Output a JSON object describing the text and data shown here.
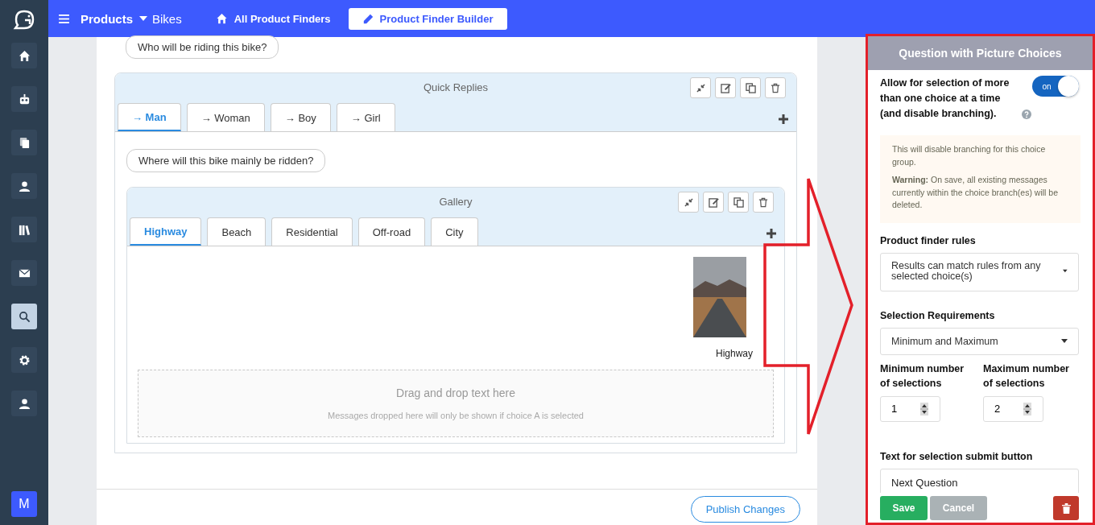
{
  "sidebar": {
    "items": [
      {
        "kind": "home",
        "selected": false
      },
      {
        "kind": "robot",
        "selected": false
      },
      {
        "kind": "documents",
        "selected": false
      },
      {
        "kind": "user",
        "selected": false
      },
      {
        "kind": "books",
        "selected": false
      },
      {
        "kind": "mail",
        "selected": false
      },
      {
        "kind": "search",
        "selected": true
      },
      {
        "kind": "settings",
        "selected": false
      },
      {
        "kind": "user",
        "selected": false
      }
    ],
    "avatar": "M"
  },
  "topbar": {
    "section": "Products",
    "subsection": "Bikes",
    "nav": [
      {
        "label": "All Product Finders",
        "kind": "home",
        "selected": false
      },
      {
        "label": "Product Finder Builder",
        "kind": "edit",
        "selected": true
      }
    ]
  },
  "builder": {
    "question_1": "Who will be riding this bike?",
    "quick_replies": {
      "title": "Quick Replies",
      "tabs": [
        {
          "label": "→ Man",
          "selected": true
        },
        {
          "label": "→ Woman",
          "selected": false
        },
        {
          "label": "→ Boy",
          "selected": false
        },
        {
          "label": "→ Girl",
          "selected": false
        }
      ],
      "question_2": "Where will this bike mainly be ridden?",
      "gallery": {
        "title": "Gallery",
        "tabs": [
          {
            "label": "Highway",
            "selected": true
          },
          {
            "label": "Beach",
            "selected": false
          },
          {
            "label": "Residential",
            "selected": false
          },
          {
            "label": "Off-road",
            "selected": false
          },
          {
            "label": "City",
            "selected": false
          }
        ],
        "choice_caption": "Highway",
        "dropzone": {
          "title": "Drag and drop text here",
          "hint": "Messages dropped here will only be shown if choice A is selected"
        }
      }
    },
    "publish_button": "Publish Changes"
  },
  "panel": {
    "title": "Question with Picture Choices",
    "multi_select": {
      "label": "Allow for selection of more than one choice at a time (and disable branching).",
      "toggle_text": "on",
      "on": true
    },
    "notice": {
      "text": "This will disable branching for this choice group.",
      "warning": "**Warning:** On save, all existing messages currently within the choice branch(es) will be deleted."
    },
    "rules": {
      "label": "Product finder rules",
      "value": "Results can match rules from any selected choice(s)"
    },
    "requirements": {
      "label": "Selection Requirements",
      "value": "Minimum and Maximum"
    },
    "minimum": {
      "label": "Minimum number of selections",
      "value": "1"
    },
    "maximum": {
      "label": "Maximum number of selections",
      "value": "2"
    },
    "submit_text": {
      "label": "Text for selection submit button",
      "value": "Next Question"
    },
    "buttons": {
      "save": "Save",
      "cancel": "Cancel"
    }
  }
}
